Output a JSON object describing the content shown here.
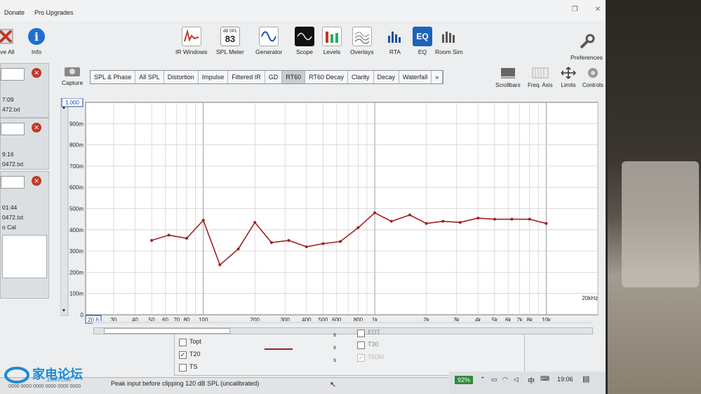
{
  "menu": {
    "items": [
      "Donate",
      "Pro Upgrades"
    ]
  },
  "left_toolbar": {
    "remove_all": "ove All",
    "info": "Info"
  },
  "toolbar": {
    "buttons": [
      {
        "label": "IR Windows",
        "icon": "ir-windows-icon"
      },
      {
        "label": "SPL Meter",
        "icon": "spl-meter-icon",
        "badge_top": "dB SPL",
        "badge_value": "83"
      },
      {
        "label": "Generator",
        "icon": "generator-icon"
      },
      {
        "label": "Scope",
        "icon": "scope-icon"
      },
      {
        "label": "Levels",
        "icon": "levels-icon"
      },
      {
        "label": "Overlays",
        "icon": "overlays-icon"
      },
      {
        "label": "RTA",
        "icon": "rta-icon"
      },
      {
        "label": "EQ",
        "icon": "eq-icon"
      },
      {
        "label": "Room Sim",
        "icon": "room-sim-icon"
      }
    ],
    "preferences": "Preferences"
  },
  "capture": {
    "label": "Capture"
  },
  "measurements": [
    {
      "time": "7:09",
      "file": "472.txt"
    },
    {
      "time": "9:16",
      "file": "0472.txt"
    },
    {
      "time": "01:44",
      "file": "0472.txt",
      "extra": "o Cal"
    }
  ],
  "tabs": [
    {
      "label": "SPL & Phase",
      "active": false
    },
    {
      "label": "All SPL",
      "active": false
    },
    {
      "label": "Distortion",
      "active": false
    },
    {
      "label": "Impulse",
      "active": false
    },
    {
      "label": "Filtered IR",
      "active": false
    },
    {
      "label": "GD",
      "active": false
    },
    {
      "label": "RT60",
      "active": true
    },
    {
      "label": "RT60 Decay",
      "active": false
    },
    {
      "label": "Clarity",
      "active": false
    },
    {
      "label": "Decay",
      "active": false
    },
    {
      "label": "Waterfall",
      "active": false
    },
    {
      "label": "»",
      "active": false
    }
  ],
  "right_tools": {
    "scrollbars": "Scrollbars",
    "freq_axis": "Freq. Axis",
    "limits": "Limits",
    "controls": "Controls"
  },
  "chart_data": {
    "type": "line",
    "xscale": "log",
    "xlim": [
      20.6,
      20000
    ],
    "ylim": [
      0,
      1.0
    ],
    "ytop_label": "1.000",
    "xleft_label": "20.6",
    "ymin_label": "0",
    "y_ticks": [
      {
        "v": 0.1,
        "label": "100m"
      },
      {
        "v": 0.2,
        "label": "200m"
      },
      {
        "v": 0.3,
        "label": "300m"
      },
      {
        "v": 0.4,
        "label": "400m"
      },
      {
        "v": 0.5,
        "label": "500m"
      },
      {
        "v": 0.6,
        "label": "600m"
      },
      {
        "v": 0.7,
        "label": "700m"
      },
      {
        "v": 0.8,
        "label": "800m"
      },
      {
        "v": 0.9,
        "label": "900m"
      }
    ],
    "x_ticks": [
      {
        "v": 30,
        "label": "30"
      },
      {
        "v": 40,
        "label": "40"
      },
      {
        "v": 50,
        "label": "50"
      },
      {
        "v": 60,
        "label": "60"
      },
      {
        "v": 70,
        "label": "70"
      },
      {
        "v": 80,
        "label": "80"
      },
      {
        "v": 100,
        "label": "100"
      },
      {
        "v": 200,
        "label": "200"
      },
      {
        "v": 300,
        "label": "300"
      },
      {
        "v": 400,
        "label": "400"
      },
      {
        "v": 500,
        "label": "500"
      },
      {
        "v": 600,
        "label": "600"
      },
      {
        "v": 800,
        "label": "800"
      },
      {
        "v": 1000,
        "label": "1k"
      },
      {
        "v": 2000,
        "label": "2k"
      },
      {
        "v": 3000,
        "label": "3k"
      },
      {
        "v": 4000,
        "label": "4k"
      },
      {
        "v": 5000,
        "label": "5k"
      },
      {
        "v": 6000,
        "label": "6k"
      },
      {
        "v": 7000,
        "label": "7k"
      },
      {
        "v": 8000,
        "label": "8k"
      },
      {
        "v": 10000,
        "label": "10k"
      },
      {
        "v": 20000,
        "label": "20kHz"
      }
    ],
    "series": [
      {
        "name": "T20",
        "color": "#a0201c",
        "x": [
          50,
          63,
          80,
          100,
          125,
          160,
          200,
          250,
          315,
          400,
          500,
          630,
          800,
          1000,
          1250,
          1600,
          2000,
          2500,
          3150,
          4000,
          5000,
          6300,
          8000,
          10000
        ],
        "y": [
          0.35,
          0.375,
          0.36,
          0.445,
          0.235,
          0.31,
          0.435,
          0.34,
          0.35,
          0.32,
          0.335,
          0.345,
          0.41,
          0.48,
          0.44,
          0.47,
          0.43,
          0.44,
          0.435,
          0.455,
          0.45,
          0.45,
          0.45,
          0.43
        ]
      }
    ]
  },
  "legend": {
    "items": [
      {
        "label": "Topt",
        "checked": false,
        "unit": "s"
      },
      {
        "label": "T20",
        "checked": true,
        "unit": "s"
      },
      {
        "label": "TS",
        "checked": false,
        "unit": "s"
      },
      {
        "label": "EDT",
        "checked": false
      },
      {
        "label": "T30",
        "checked": false
      },
      {
        "label": "T60M",
        "checked": true
      }
    ]
  },
  "status": {
    "message": "Peak input before clipping 120 dB SPL (uncalibrated)",
    "codes": "0000 0000  0000 0000  0000 0000"
  },
  "taskbar": {
    "battery": "92%",
    "ime": "中",
    "time": "19:06"
  },
  "watermark": {
    "text": "家电论坛",
    "sub": "JDBBS.COM"
  }
}
